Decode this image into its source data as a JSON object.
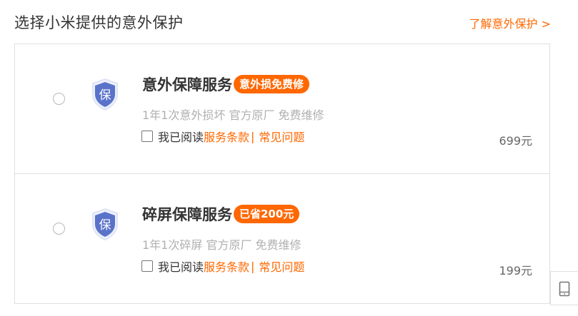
{
  "header": {
    "title": "选择小米提供的意外保护",
    "link": "了解意外保护 >"
  },
  "cards": [
    {
      "icon_text": "保",
      "title": "意外保障服务",
      "badge": "意外损免费修",
      "desc": "1年1次意外损坏 官方原厂 免费维修",
      "terms_prefix": "我已阅读",
      "terms_link": "服务条款",
      "separator": "|",
      "faq_link": "常见问题",
      "price": "699元"
    },
    {
      "icon_text": "保",
      "title": "碎屏保障服务",
      "badge": "已省200元",
      "desc": "1年1次碎屏 官方原厂 免费维修",
      "terms_prefix": "我已阅读",
      "terms_link": "服务条款",
      "separator": "|",
      "faq_link": "常见问题",
      "price": "199元"
    }
  ],
  "side": {
    "icon": "tablet-icon"
  },
  "colors": {
    "accent": "#ff6700",
    "shield": "#5a73c9",
    "border": "#e0e0e0"
  }
}
